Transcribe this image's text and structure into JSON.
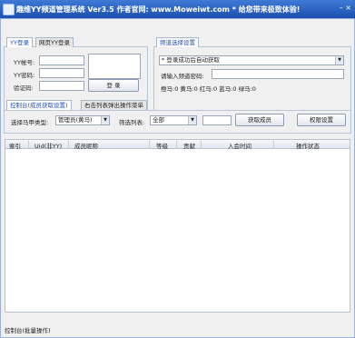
{
  "titlebar": {
    "title": "趣维YY频道管理系统 Ver3.5   作者官网: www.Moweiwt.com   *   给您带来极致体验!",
    "controls": "–  ×"
  },
  "login": {
    "tabs": [
      "YY登录",
      "网页YY登录"
    ],
    "yy_label": "YY帐号:",
    "pwd_label": "YY密码:",
    "captcha_label": "验证码:",
    "login_button": "登 录"
  },
  "channel": {
    "title": "频道选择设置",
    "select_value": "* 登录成功后自动获取",
    "pwd_label": "请输入频道密码:",
    "stats": "橙马:0  黄马:0  红马:0  蓝马:0  绿马:0"
  },
  "controls": {
    "tabs": [
      "控制台(成员获取设置)",
      "右击列表弹出操作菜单"
    ],
    "member_type_label": "选择马甲类型:",
    "member_type_value": "管理员(黄马)",
    "filter_label": "筛选列表:",
    "filter_value": "全部",
    "get_button": "获取成员",
    "perm_button": "权限设置"
  },
  "table": {
    "columns": [
      "索引",
      "Uid(非YY)",
      "成员昵称",
      "等级",
      "贡献",
      "入会时间",
      "操作状态"
    ]
  },
  "status": {
    "text": "控制台(批量操作)"
  }
}
